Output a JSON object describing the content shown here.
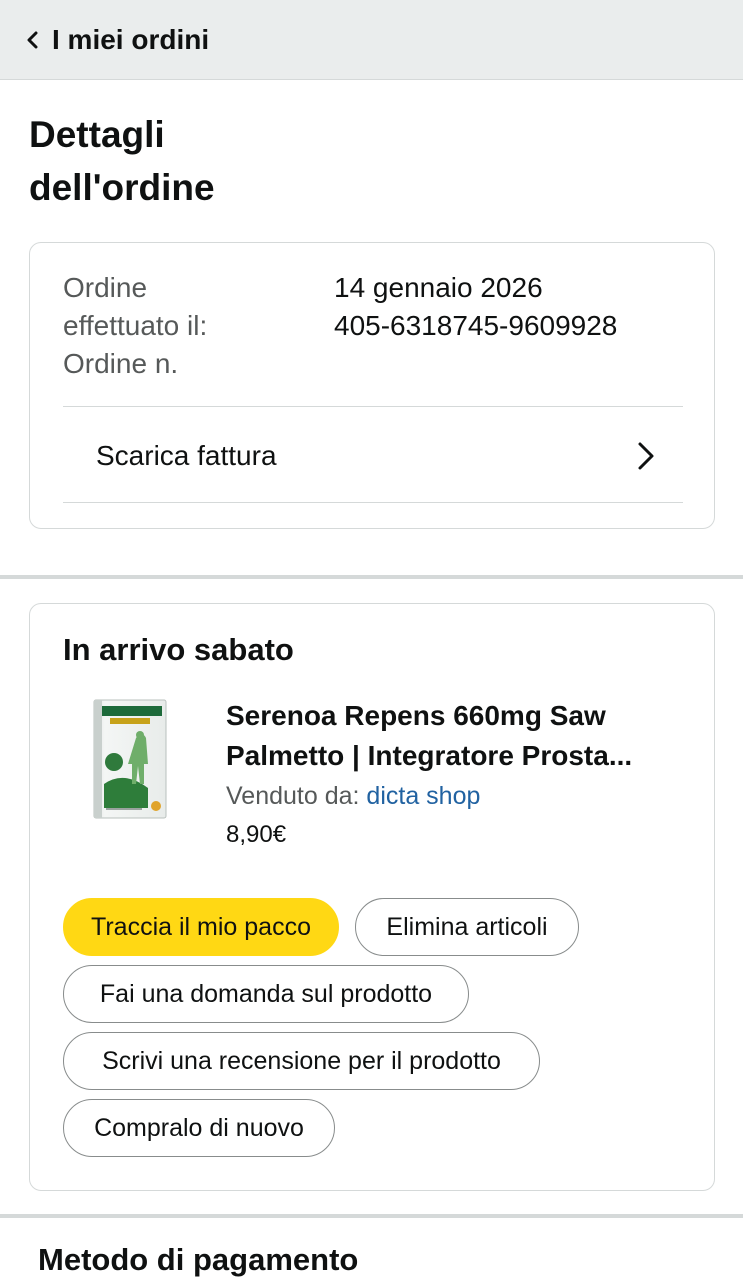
{
  "header": {
    "back_label": "I miei ordini",
    "back_icon": "chevron-left-icon"
  },
  "page": {
    "title_line1": "Dettagli",
    "title_line2": "dell'ordine"
  },
  "order_summary": {
    "date_label_line1": "Ordine",
    "date_label_line2": "effettuato il:",
    "number_label": "Ordine n.",
    "date_value": "14 gennaio 2026",
    "number_value": "405-6318745-9609928",
    "invoice_label": "Scarica fattura",
    "invoice_icon": "chevron-right-icon"
  },
  "delivery": {
    "status_title": "In arrivo sabato",
    "product": {
      "title_line1": "Serenoa Repens 660mg Saw",
      "title_line2": "Palmetto | Integratore Prosta...",
      "sold_by_label": "Venduto da:",
      "seller_name": "dicta shop",
      "price": "8,90€",
      "image_icon": "product-box-image"
    },
    "actions": {
      "track": "Traccia il mio pacco",
      "remove": "Elimina articoli",
      "ask": "Fai una domanda sul prodotto",
      "review": "Scrivi una recensione per il prodotto",
      "buy_again": "Compralo di nuovo"
    }
  },
  "payment": {
    "title": "Metodo di pagamento"
  },
  "colors": {
    "header_bg": "#eaeded",
    "primary_button": "#ffd814",
    "link": "#2162a1",
    "muted_text": "#565959",
    "border": "#d5d9d9"
  }
}
